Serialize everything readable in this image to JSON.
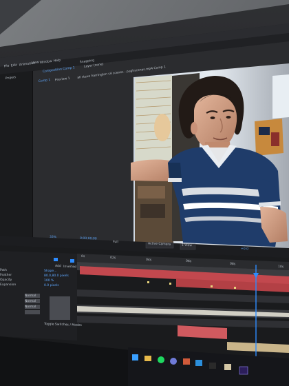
{
  "photo_subject": "photo of a monitor running After Effects, editing a video clip of a young man in a blue striped polo",
  "app": {
    "menu": [
      "File",
      "Edit",
      "Animation",
      "View",
      "Window",
      "Help"
    ],
    "snapping_label": "Snapping",
    "composition_tab": "Composition Comp 1",
    "layer_tab": "Layer (none)",
    "comp_tab": "Comp 1",
    "breadcrumb": "all steve harrington s4 scenes - pughscenes.mp4 Comp 1",
    "project_label": "Project",
    "preview_label": "Preview 1"
  },
  "viewer": {
    "zoom": "33%",
    "timecode": "0;00;00;00",
    "resolution": "Full",
    "camera": "Active Camera",
    "view": "1 View",
    "exposure": "+0.0"
  },
  "timeline": {
    "ruler": [
      "0s",
      "02s",
      "04s",
      "06s",
      "08s",
      "10s"
    ],
    "footer": "Toggle Switches / Modes",
    "props": [
      "Path",
      "Feather",
      "Opacity",
      "Expansion"
    ],
    "mode_label": "Add",
    "inverted_label": "Inverted",
    "values": [
      "Shape...",
      "80.0,80.0 pixels",
      "100 %",
      "0.0 pixels"
    ],
    "mode_values": [
      "Normal",
      "Normal",
      "Normal"
    ]
  },
  "colors": {
    "ui_dark": "#1e1f22",
    "accent_blue": "#2d8cff",
    "track_red": "#c2484e",
    "shirt_blue": "#1f3c6a"
  }
}
